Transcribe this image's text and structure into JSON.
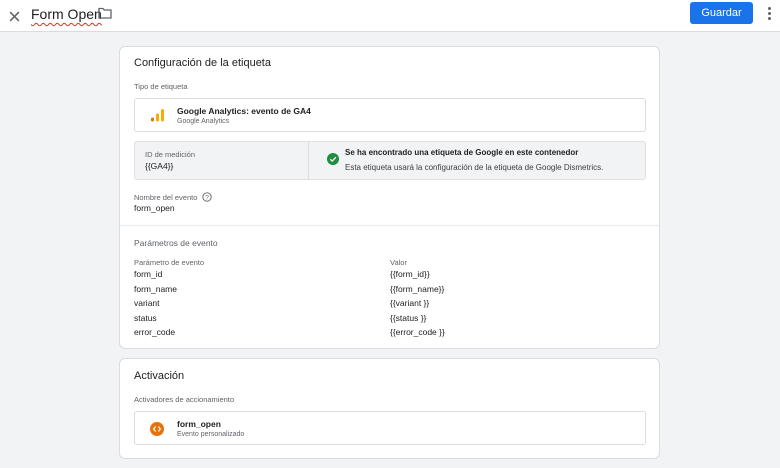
{
  "header": {
    "title": "Form Open",
    "save_label": "Guardar"
  },
  "tag_config": {
    "heading": "Configuración de la etiqueta",
    "tag_type_label": "Tipo de etiqueta",
    "tag_type_name": "Google Analytics: evento de GA4",
    "tag_type_sub": "Google Analytics",
    "measurement_label": "ID de medición",
    "measurement_value": "{{GA4}}",
    "notice_title": "Se ha encontrado una etiqueta de Google en este contenedor",
    "notice_body": "Esta etiqueta usará la configuración de la etiqueta de Google Dismetrics.",
    "event_name_label": "Nombre del evento",
    "event_name_value": "form_open",
    "params_heading": "Parámetros de evento",
    "params_col_param": "Parámetro de evento",
    "params_col_value": "Valor",
    "params": [
      {
        "name": "form_id",
        "value": "{{form_id}}"
      },
      {
        "name": "form_name",
        "value": "{{form_name}}"
      },
      {
        "name": "variant",
        "value": "{{variant }}"
      },
      {
        "name": "status",
        "value": "{{status }}"
      },
      {
        "name": "error_code",
        "value": "{{error_code }}"
      }
    ]
  },
  "activation": {
    "heading": "Activación",
    "triggers_label": "Activadores de accionamiento",
    "trigger_name": "form_open",
    "trigger_sub": "Evento personalizado"
  },
  "colors": {
    "accent": "#1a73e8",
    "success": "#1e8e3e",
    "trigger": "#e8710a",
    "ga_bars": [
      "#f9ab00",
      "#e37400"
    ]
  },
  "icons": [
    "close-icon",
    "folder-icon",
    "more-vert-icon",
    "google-analytics-icon",
    "check-circle-icon",
    "help-icon",
    "custom-event-icon"
  ]
}
